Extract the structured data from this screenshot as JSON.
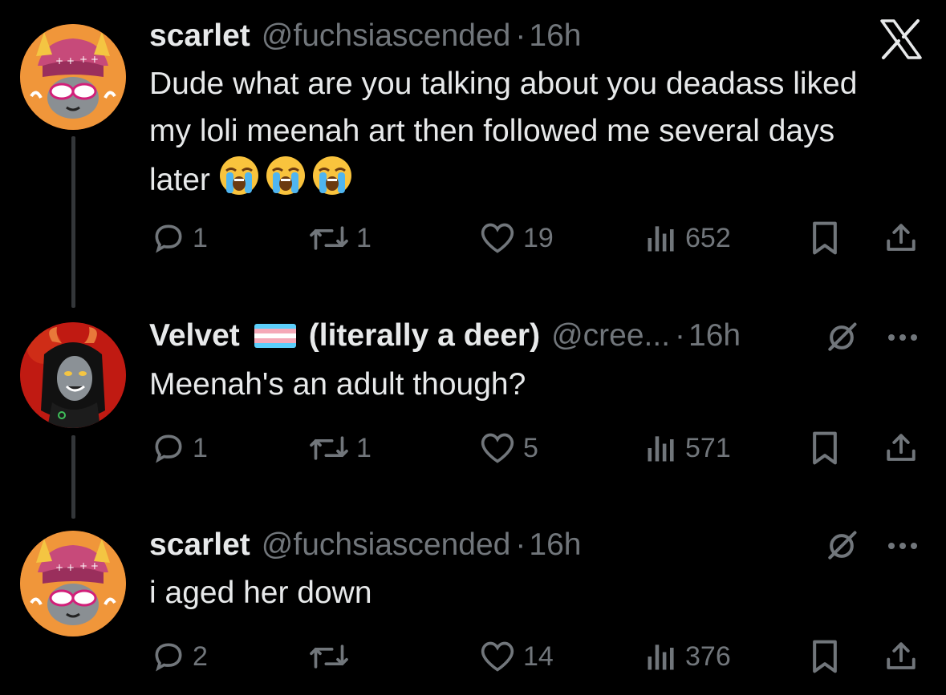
{
  "tweets": [
    {
      "display_name": "scarlet",
      "handle": "@fuchsiascended",
      "separator": "·",
      "time": "16h",
      "text": "Dude what are you talking about you deadass liked my loli meenah art then followed me several days later",
      "emojis": [
        "😭",
        "😭",
        "😭"
      ],
      "replies": "1",
      "reposts": "1",
      "likes": "19",
      "views": "652"
    },
    {
      "display_name_part1": "Velvet",
      "display_name_part2": "(literally a deer)",
      "handle": "@cree...",
      "separator": "·",
      "time": "16h",
      "text": "Meenah's an adult though?",
      "replies": "1",
      "reposts": "1",
      "likes": "5",
      "views": "571"
    },
    {
      "display_name": "scarlet",
      "handle": "@fuchsiascended",
      "separator": "·",
      "time": "16h",
      "text": "i aged her down",
      "replies": "2",
      "reposts": "",
      "likes": "14",
      "views": "376"
    }
  ],
  "colors": {
    "background": "#000000",
    "primary_text": "#e7e9ea",
    "secondary_text": "#71767b",
    "thread_line": "#333639",
    "trans_flag": [
      "#5bcefa",
      "#f5a9b8",
      "#ffffff",
      "#f5a9b8",
      "#5bcefa"
    ]
  },
  "icons": [
    "x-logo-icon",
    "reply-icon",
    "repost-icon",
    "like-icon",
    "views-icon",
    "bookmark-icon",
    "share-icon",
    "grok-icon",
    "more-icon",
    "trans-flag-icon",
    "loudly-crying-face-icon"
  ]
}
